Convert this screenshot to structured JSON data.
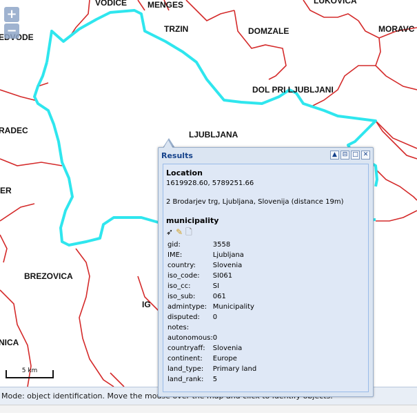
{
  "map": {
    "zoom_in": "+",
    "zoom_out": "−",
    "labels": [
      {
        "id": "vodice",
        "text": "VODICE"
      },
      {
        "id": "menges",
        "text": "MENGES"
      },
      {
        "id": "lukovica",
        "text": "LUKOVICA"
      },
      {
        "id": "medvode",
        "text": "EDVODE"
      },
      {
        "id": "trzin",
        "text": "TRZIN"
      },
      {
        "id": "domzale",
        "text": "DOMZALE"
      },
      {
        "id": "moravce",
        "text": "MORAVC"
      },
      {
        "id": "dol",
        "text": "DOL PRI LJUBLJANI"
      },
      {
        "id": "gradec",
        "text": "RADEC"
      },
      {
        "id": "ljubljana",
        "text": "LJUBLJANA"
      },
      {
        "id": "er",
        "text": "ER"
      },
      {
        "id": "brezovica",
        "text": "BREZOVICA"
      },
      {
        "id": "ig",
        "text": "IG"
      },
      {
        "id": "nica",
        "text": "NICA"
      }
    ],
    "scale_label": "5 km",
    "boundary_color": "#d42a2a",
    "highlight_color": "#2fe6ee"
  },
  "status": {
    "text": "Mode: object identification. Move the mouse over the map and click to identify objects."
  },
  "popup": {
    "title": "Results",
    "tools": [
      "▲",
      "⊟",
      "□",
      "✕"
    ],
    "location_heading": "Location",
    "coordinates": "1619928.60, 5789251.66",
    "address": "2 Brodarjev trg, Ljubljana, Slovenija (distance 19m)",
    "layer_heading": "municipality",
    "attributes": [
      {
        "key": "gid:",
        "value": "3558"
      },
      {
        "key": "IME:",
        "value": "Ljubljana"
      },
      {
        "key": "country:",
        "value": "Slovenia"
      },
      {
        "key": "iso_code:",
        "value": "SI061"
      },
      {
        "key": "iso_cc:",
        "value": "SI"
      },
      {
        "key": "iso_sub:",
        "value": "061"
      },
      {
        "key": "admintype:",
        "value": "Municipality"
      },
      {
        "key": "disputed:",
        "value": "0"
      },
      {
        "key": "notes:",
        "value": ""
      },
      {
        "key": "autonomous:",
        "value": "0"
      },
      {
        "key": "countryaff:",
        "value": "Slovenia"
      },
      {
        "key": "continent:",
        "value": "Europe"
      },
      {
        "key": "land_type:",
        "value": "Primary land"
      },
      {
        "key": "land_rank:",
        "value": "5"
      }
    ]
  }
}
